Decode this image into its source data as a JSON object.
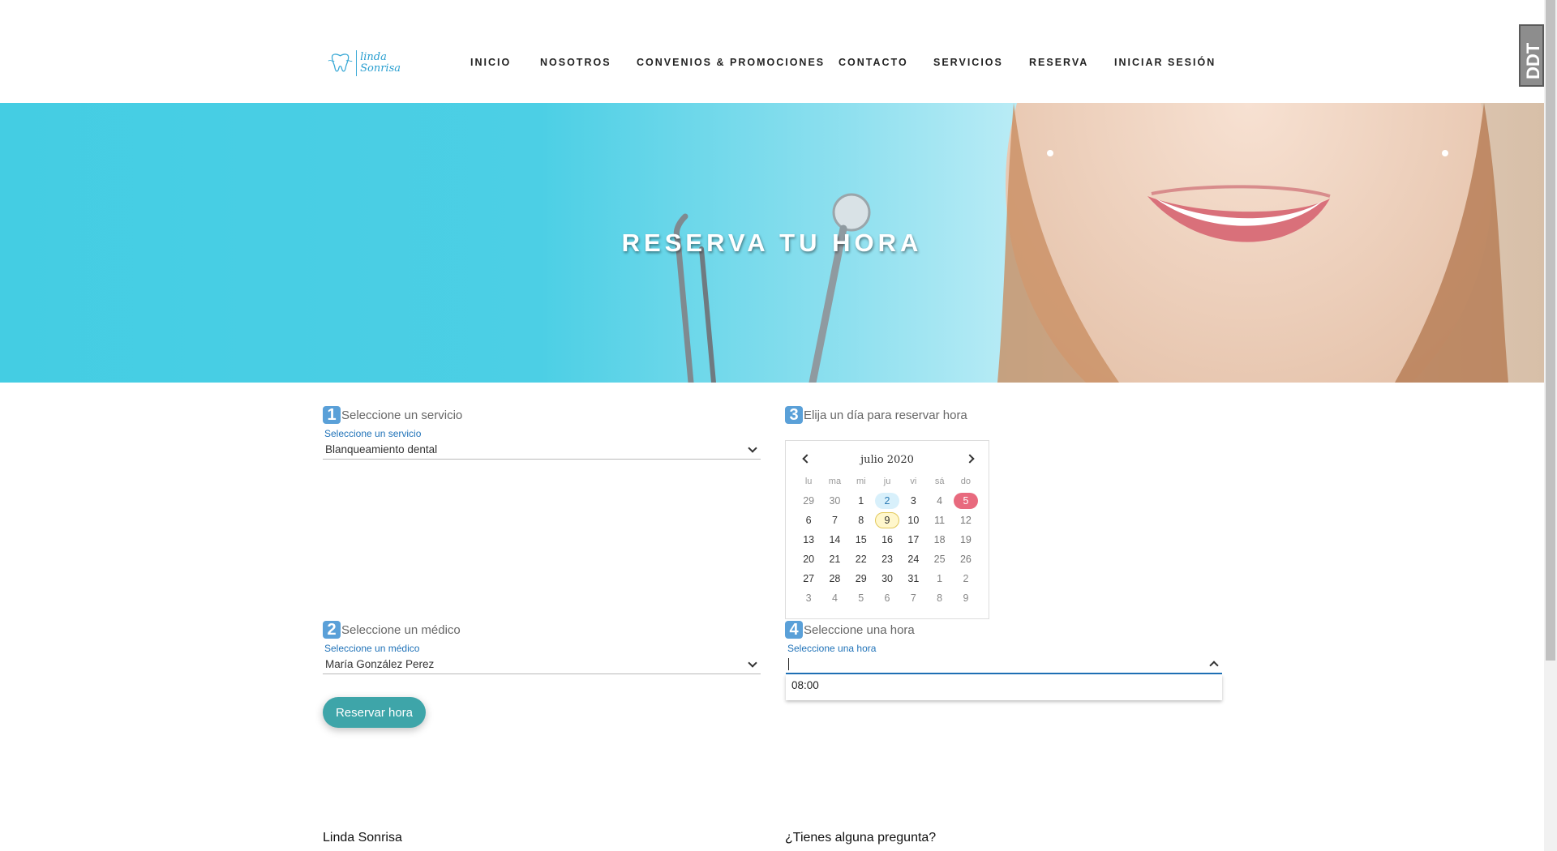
{
  "brand": {
    "line1": "linda",
    "line2": "Sonrisa"
  },
  "nav": {
    "items": [
      {
        "label": "INICIO"
      },
      {
        "label": "NOSOTROS"
      },
      {
        "label": "CONVENIOS & PROMOCIONES"
      },
      {
        "label": "CONTACTO"
      },
      {
        "label": "SERVICIOS"
      },
      {
        "label": "RESERVA"
      },
      {
        "label": "INICIAR SESIÓN"
      }
    ]
  },
  "extension_badge": "DDT",
  "hero": {
    "title": "RESERVA TU HORA"
  },
  "form": {
    "step1": {
      "num": "1",
      "label": "Seleccione un servicio",
      "float_label": "Seleccione un servicio",
      "value": "Blanqueamiento dental"
    },
    "step2": {
      "num": "2",
      "label": "Seleccione un médico",
      "float_label": "Seleccione un médico",
      "value": "María González Perez"
    },
    "step3": {
      "num": "3",
      "label": "Elija un día para reservar hora"
    },
    "step4": {
      "num": "4",
      "label": "Seleccione una hora",
      "float_label": "Seleccione una hora",
      "value": "",
      "options": [
        "08:00"
      ]
    },
    "submit_label": "Reservar hora"
  },
  "calendar": {
    "month_label": "julio 2020",
    "weekdays": [
      "lu",
      "ma",
      "mi",
      "ju",
      "vi",
      "sá",
      "do"
    ],
    "weeks": [
      [
        "29",
        "30",
        "1",
        "2",
        "3",
        "4",
        "5"
      ],
      [
        "6",
        "7",
        "8",
        "9",
        "10",
        "11",
        "12"
      ],
      [
        "13",
        "14",
        "15",
        "16",
        "17",
        "18",
        "19"
      ],
      [
        "20",
        "21",
        "22",
        "23",
        "24",
        "25",
        "26"
      ],
      [
        "27",
        "28",
        "29",
        "30",
        "31",
        "1",
        "2"
      ],
      [
        "3",
        "4",
        "5",
        "6",
        "7",
        "8",
        "9"
      ]
    ],
    "today": "2",
    "selected": "5",
    "highlighted": "9"
  },
  "footer": {
    "brand": "Linda Sonrisa",
    "question": "¿Tienes alguna pregunta?"
  },
  "colors": {
    "accent": "#5aa0d8",
    "button": "#3ea5a9",
    "selected_day": "#e86a7e",
    "hero": "#44cde3"
  }
}
